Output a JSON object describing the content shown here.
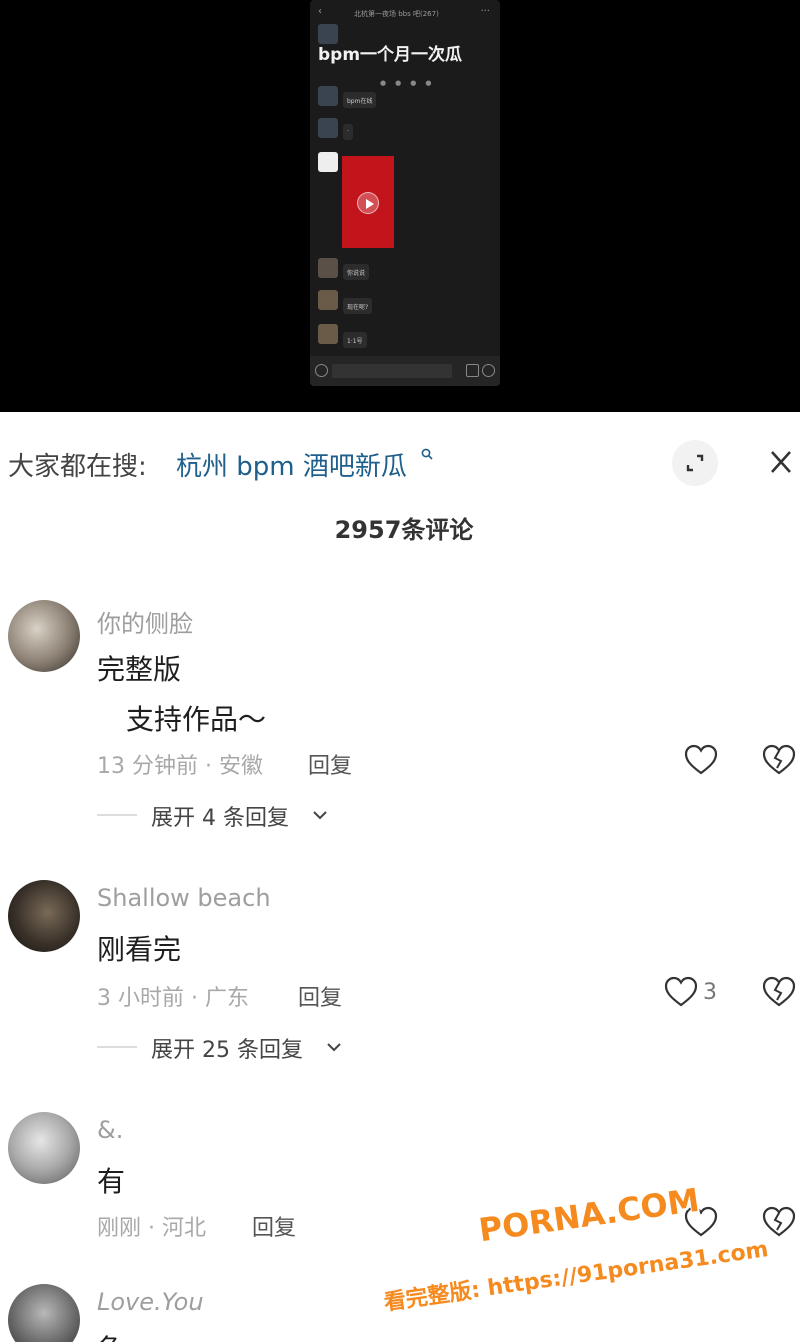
{
  "video": {
    "chat_title": "北杭第一夜场 bbs 吧(267)",
    "headline": "bpm一个月一次瓜",
    "messages": [
      "bpm在线",
      "·",
      "你说说",
      "现在呢?",
      "1·1号"
    ]
  },
  "search": {
    "prefix": "大家都在搜:",
    "query": "杭州 bpm 酒吧新瓜"
  },
  "comments_header": {
    "count_label": "2957条评论"
  },
  "comments": [
    {
      "username": "你的侧脸",
      "text_lines": [
        "完整版",
        "支持作品～"
      ],
      "time_location": "13 分钟前 · 安徽",
      "reply_label": "回复",
      "likes": "",
      "expand_label": "展开 4 条回复"
    },
    {
      "username": "Shallow beach",
      "text_lines": [
        "刚看完"
      ],
      "time_location": "3 小时前 · 广东",
      "reply_label": "回复",
      "likes": "3",
      "expand_label": "展开 25 条回复"
    },
    {
      "username": "&.",
      "text_lines": [
        "有"
      ],
      "time_location": "刚刚 · 河北",
      "reply_label": "回复",
      "likes": ""
    },
    {
      "username": "Love.You",
      "text_lines": [
        "急"
      ]
    }
  ],
  "watermark": {
    "logo": "PORNA.COM",
    "text": "看完整版: https://91porna31.com"
  },
  "colors": {
    "link": "#1f5f8b",
    "watermark": "#f58a1f",
    "video_red": "#c3141b"
  }
}
